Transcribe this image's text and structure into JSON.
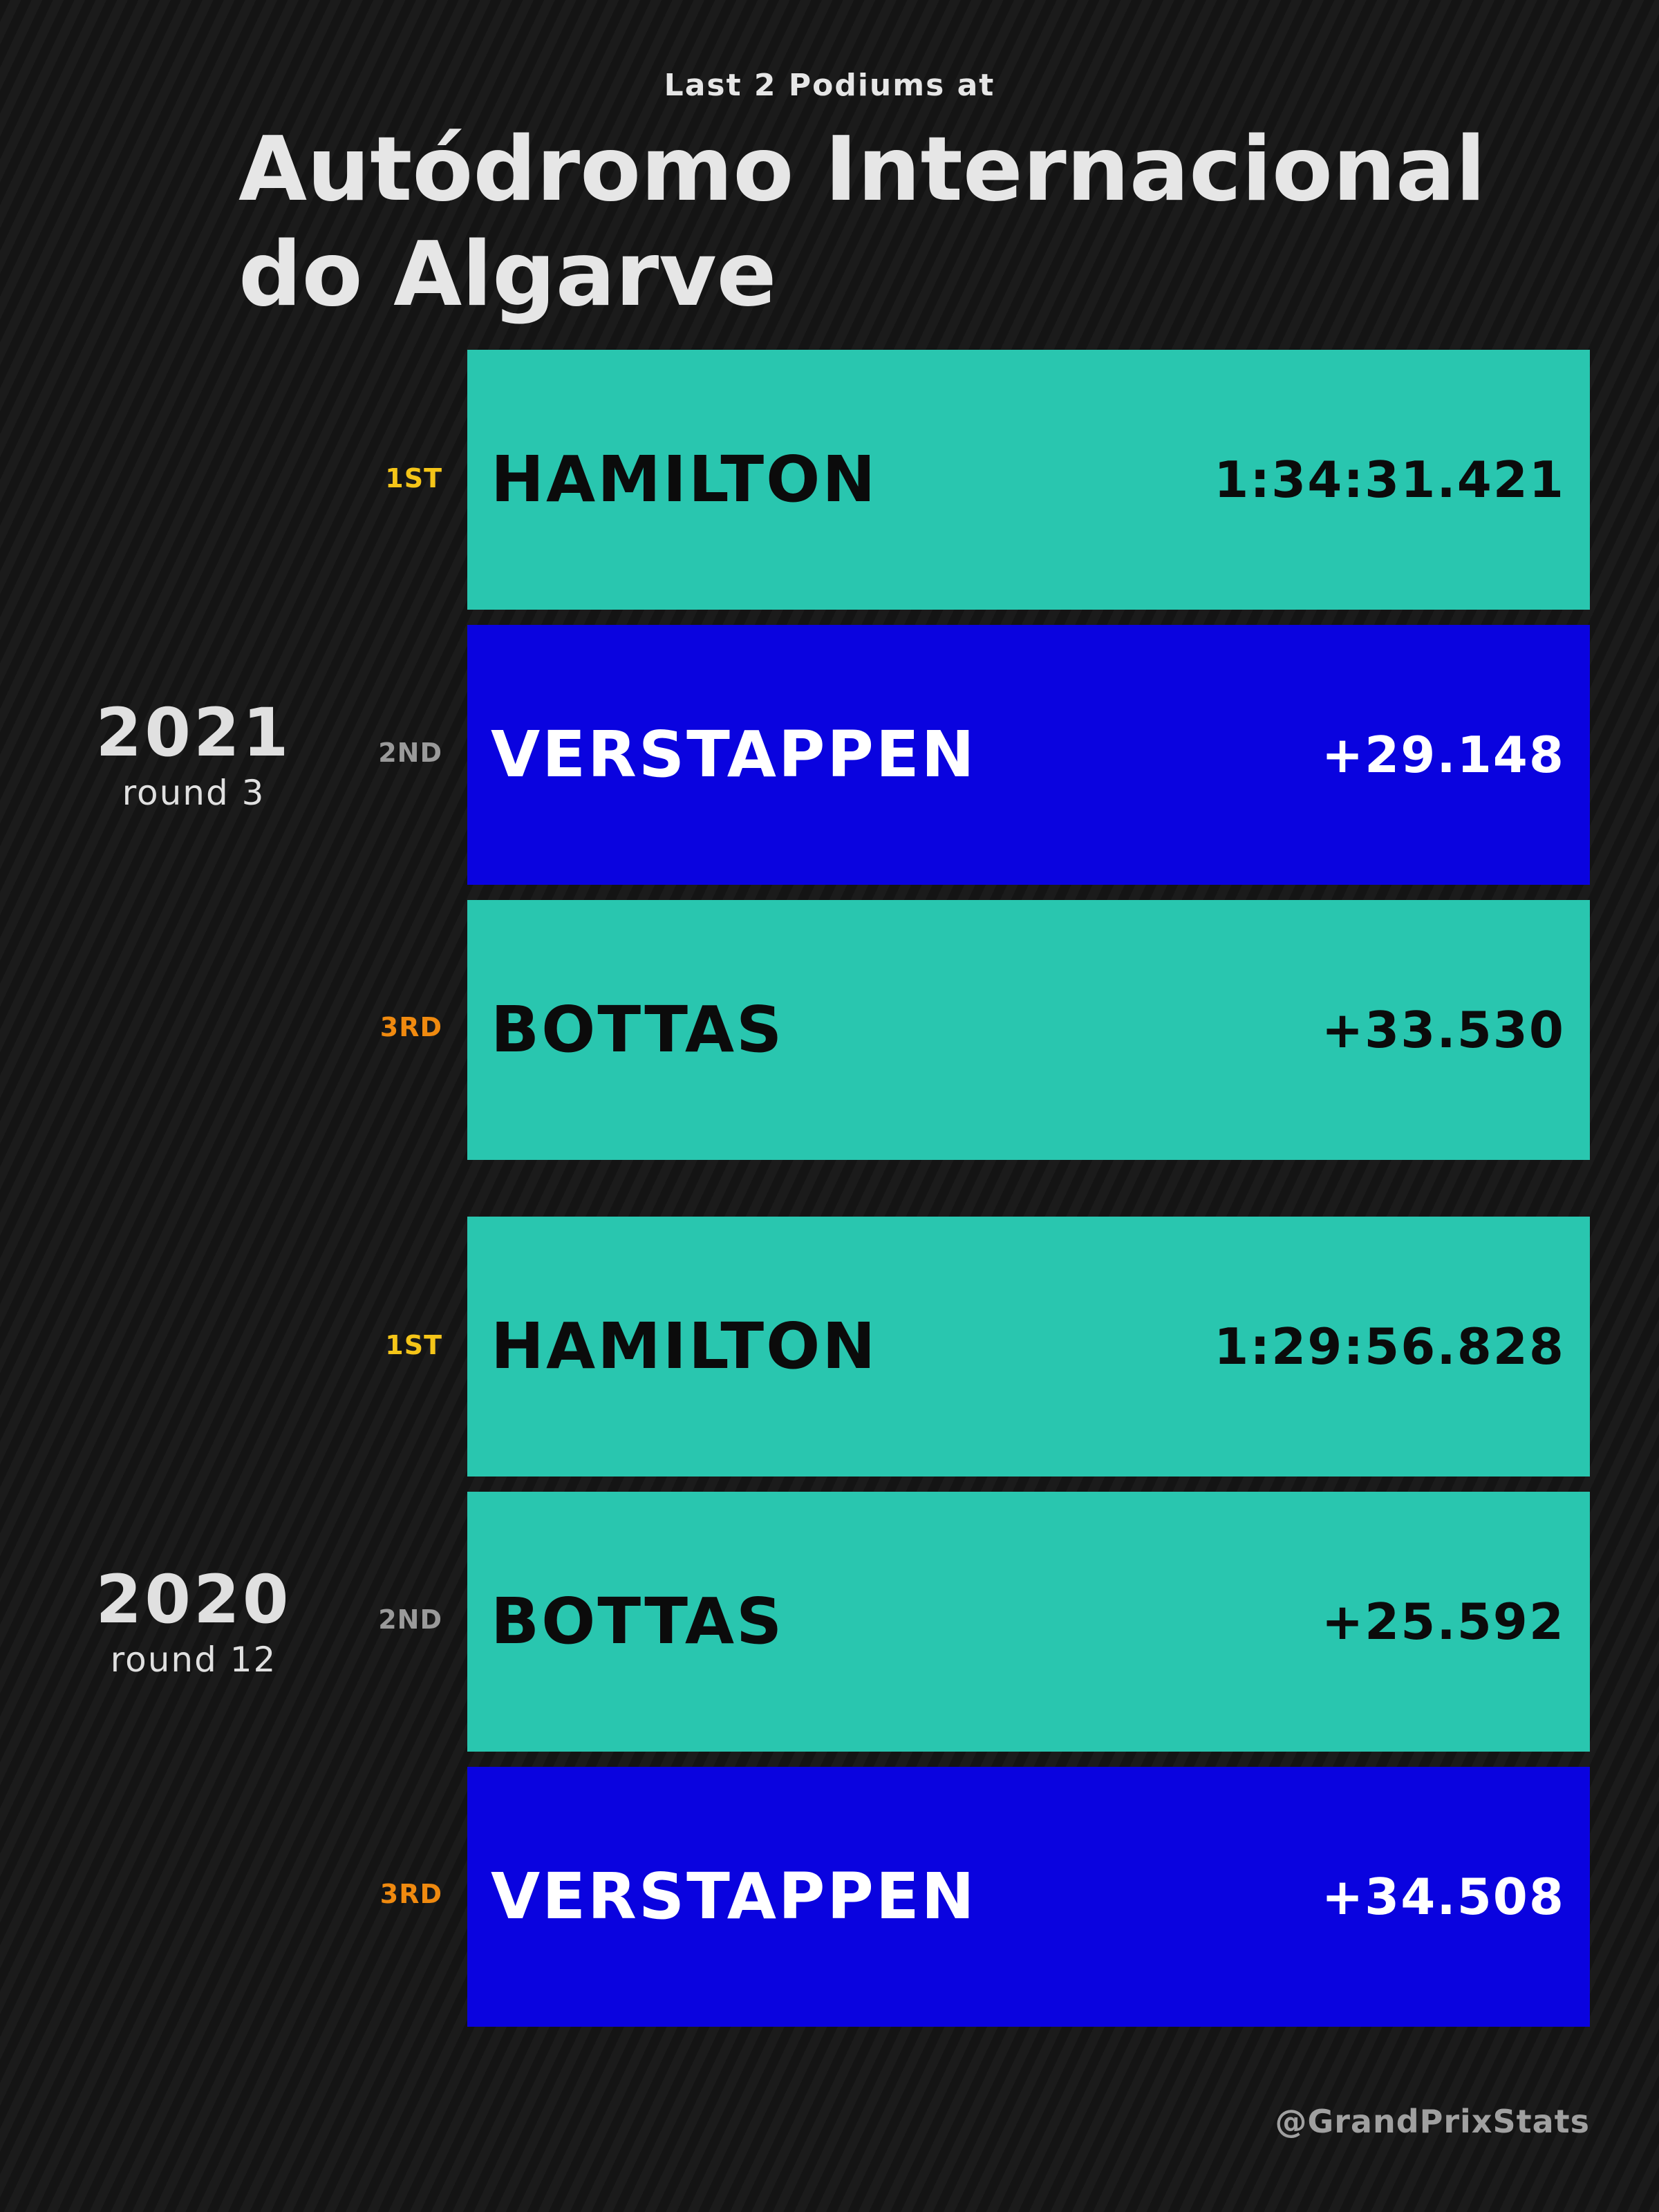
{
  "header": {
    "subtitle": "Last 2 Podiums at",
    "title_line1": "Autódromo Internacional",
    "title_line2": "do Algarve"
  },
  "colors": {
    "mercedes": "#29C6AF",
    "red_bull": "#0A03DF",
    "first": "#F5C518",
    "second": "#9A9A9A",
    "third": "#F08A0F",
    "dark_text": "#0B0B0B",
    "light_text": "#FFFFFF"
  },
  "seasons": [
    {
      "year": "2021",
      "round": "round 3",
      "podium": [
        {
          "position": "1ST",
          "driver": "HAMILTON",
          "time": "1:34:31.421",
          "team_color": "mercedes"
        },
        {
          "position": "2ND",
          "driver": "VERSTAPPEN",
          "time": "+29.148",
          "team_color": "red_bull"
        },
        {
          "position": "3RD",
          "driver": "BOTTAS",
          "time": "+33.530",
          "team_color": "mercedes"
        }
      ]
    },
    {
      "year": "2020",
      "round": "round 12",
      "podium": [
        {
          "position": "1ST",
          "driver": "HAMILTON",
          "time": "1:29:56.828",
          "team_color": "mercedes"
        },
        {
          "position": "2ND",
          "driver": "BOTTAS",
          "time": "+25.592",
          "team_color": "mercedes"
        },
        {
          "position": "3RD",
          "driver": "VERSTAPPEN",
          "time": "+34.508",
          "team_color": "red_bull"
        }
      ]
    }
  ],
  "footer": {
    "handle": "@GrandPrixStats"
  }
}
